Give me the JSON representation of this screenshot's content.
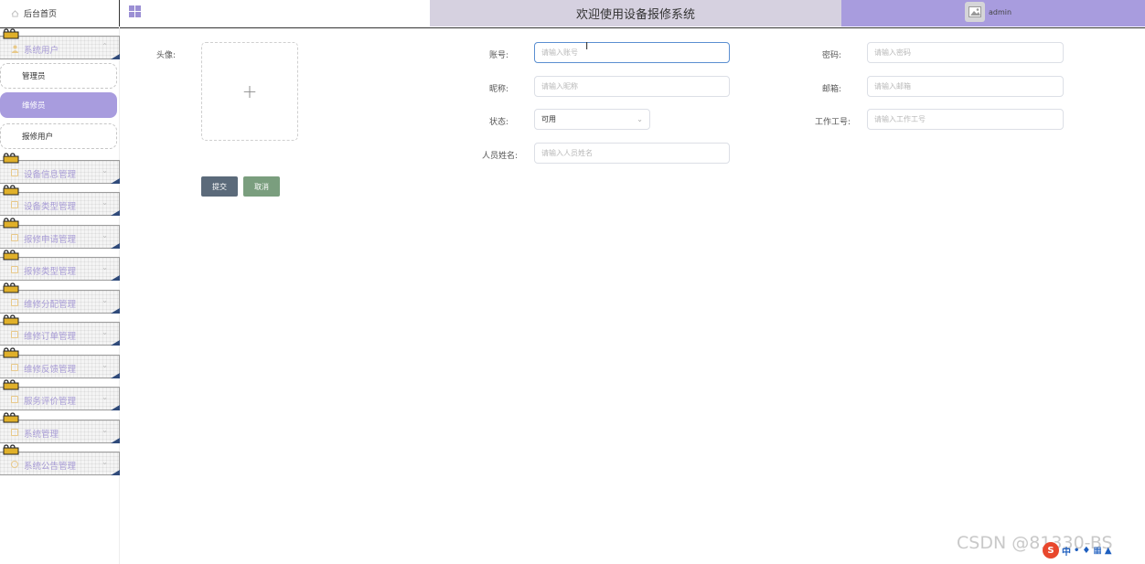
{
  "topbar": {
    "home_label": "后台首页",
    "title": "欢迎使用设备报修系统",
    "username": "admin"
  },
  "sidebar": {
    "menus": [
      {
        "label": "系统用户"
      },
      {
        "label": "设备信息管理"
      },
      {
        "label": "设备类型管理"
      },
      {
        "label": "报修申请管理"
      },
      {
        "label": "报修类型管理"
      },
      {
        "label": "维修分配管理"
      },
      {
        "label": "维修订单管理"
      },
      {
        "label": "维修反馈管理"
      },
      {
        "label": "服务评价管理"
      },
      {
        "label": "系统管理"
      },
      {
        "label": "系统公告管理"
      }
    ],
    "submenu": [
      {
        "label": "管理员",
        "active": false
      },
      {
        "label": "维修员",
        "active": true
      },
      {
        "label": "报修用户",
        "active": false
      }
    ]
  },
  "form": {
    "avatar_label": "头像:",
    "account_label": "账号:",
    "account_placeholder": "请输入账号",
    "password_label": "密码:",
    "password_placeholder": "请输入密码",
    "nickname_label": "昵称:",
    "nickname_placeholder": "请输入昵称",
    "email_label": "邮箱:",
    "email_placeholder": "请输入邮箱",
    "status_label": "状态:",
    "status_value": "可用",
    "workno_label": "工作工号:",
    "workno_placeholder": "请输入工作工号",
    "name_label": "人员姓名:",
    "name_placeholder": "请输入人员姓名",
    "submit_label": "提交",
    "cancel_label": "取消",
    "upload_plus": "+"
  },
  "overlay": {
    "watermark": "CSDN @81330-BS",
    "ime_text": "中"
  },
  "colors": {
    "accent": "#a89cde",
    "title_bg": "#d6d1e0",
    "submit_bg": "#5b6a7a",
    "cancel_bg": "#7a9e7e"
  }
}
